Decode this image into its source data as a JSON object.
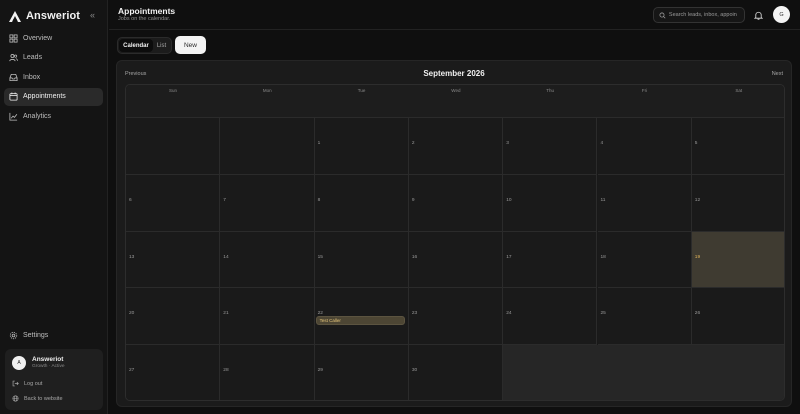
{
  "sidebar": {
    "brand": "Answeriot",
    "collapse_icon": "chevrons-left-icon",
    "items": [
      {
        "label": "Overview",
        "icon": "layout-grid-icon"
      },
      {
        "label": "Leads",
        "icon": "users-icon"
      },
      {
        "label": "Inbox",
        "icon": "inbox-icon"
      },
      {
        "label": "Appointments",
        "icon": "calendar-icon"
      },
      {
        "label": "Analytics",
        "icon": "chart-line-icon"
      }
    ],
    "active_item": "Appointments",
    "settings_label": "Settings",
    "user_card": {
      "avatar_initial": "A",
      "name": "Answeriot",
      "plan": "Growth · Active",
      "logout_label": "Log out",
      "back_label": "Back to website"
    }
  },
  "header": {
    "title": "Appointments",
    "subtitle": "Jobs on the calendar.",
    "search_placeholder": "Search leads, inbox, appoin",
    "avatar_initial": "G"
  },
  "toolbar": {
    "calendar_label": "Calendar",
    "list_label": "List",
    "active_view": "Calendar",
    "new_label": "New"
  },
  "calendar": {
    "prev_label": "Previous",
    "next_label": "Next",
    "month_label": "September 2026",
    "weekdays": [
      "Sun",
      "Mon",
      "Tue",
      "Wed",
      "Thu",
      "Fri",
      "Sat"
    ],
    "weeks": [
      [
        "",
        "",
        "1",
        "2",
        "3",
        "4",
        "5"
      ],
      [
        "6",
        "7",
        "8",
        "9",
        "10",
        "11",
        "12"
      ],
      [
        "13",
        "14",
        "15",
        "16",
        "17",
        "18",
        "19"
      ],
      [
        "20",
        "21",
        "22",
        "23",
        "24",
        "25",
        "26"
      ],
      [
        "27",
        "28",
        "29",
        "30",
        "",
        "",
        ""
      ]
    ],
    "today": "19",
    "events": [
      {
        "day": "22",
        "label": "Test Caller"
      }
    ]
  },
  "colors": {
    "accent": "#e1b55a",
    "today_bg": "#3f3b31",
    "event_bg": "#4d4634"
  }
}
